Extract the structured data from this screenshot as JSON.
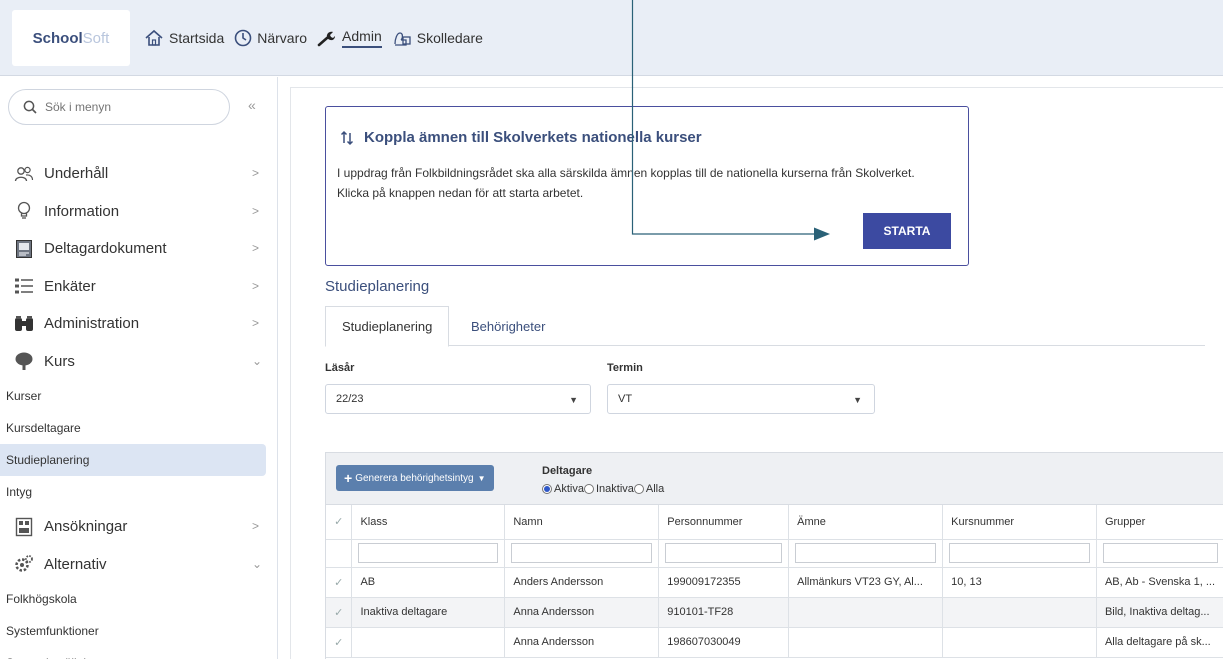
{
  "app": {
    "logo_part1": "School",
    "logo_part2": "Soft"
  },
  "topnav": [
    {
      "label": "Startsida",
      "icon": "home-icon"
    },
    {
      "label": "Närvaro",
      "icon": "clock-icon"
    },
    {
      "label": "Admin",
      "icon": "wrench-icon"
    },
    {
      "label": "Skolledare",
      "icon": "users-icon"
    }
  ],
  "sidebar": {
    "search_placeholder": "Sök i menyn",
    "collapse": "«",
    "items": [
      {
        "label": "Underhåll",
        "icon": "people-icon"
      },
      {
        "label": "Information",
        "icon": "bulb-icon"
      },
      {
        "label": "Deltagardokument",
        "icon": "document-icon"
      },
      {
        "label": "Enkäter",
        "icon": "list-icon"
      },
      {
        "label": "Administration",
        "icon": "binoculars-icon"
      },
      {
        "label": "Kurs",
        "icon": "tree-icon"
      }
    ],
    "kurs_sub": [
      "Kurser",
      "Kursdeltagare",
      "Studieplanering",
      "Intyg"
    ],
    "items2": [
      {
        "label": "Ansökningar",
        "icon": "form-icon"
      },
      {
        "label": "Alternativ",
        "icon": "gears-icon"
      }
    ],
    "alt_sub": [
      "Folkhögskola",
      "Systemfunktioner",
      "Systeminställningar"
    ]
  },
  "banner": {
    "title": "Koppla ämnen till Skolverkets nationella kurser",
    "text": "I uppdrag från Folkbildningsrådet ska alla särskilda ämnen kopplas till de nationella kurserna från Skolverket. Klicka på knappen nedan för att starta arbetet.",
    "button": "STARTA"
  },
  "page": {
    "title": "Studieplanering",
    "tabs": [
      "Studieplanering",
      "Behörigheter"
    ]
  },
  "filters": {
    "lasar_label": "Läsår",
    "lasar_value": "22/23",
    "termin_label": "Termin",
    "termin_value": "VT"
  },
  "grid": {
    "generate_button": "Generera behörighetsintyg",
    "deltagare_label": "Deltagare",
    "radio_options": [
      "Aktiva",
      "Inaktiva",
      "Alla"
    ],
    "selected_radio": "Aktiva",
    "columns": [
      "Klass",
      "Namn",
      "Personnummer",
      "Ämne",
      "Kursnummer",
      "Grupper"
    ],
    "rows": [
      [
        "AB",
        "Anders Andersson",
        "199009172355",
        "Allmänkurs VT23 GY, Al...",
        "10, 13",
        "AB, Ab - Svenska 1, ..."
      ],
      [
        "Inaktiva deltagare",
        "Anna Andersson",
        "910101-TF28",
        "",
        "",
        "Bild, Inaktiva deltag..."
      ],
      [
        "",
        "Anna Andersson",
        "198607030049",
        "",
        "",
        "Alla deltagare på sk..."
      ]
    ]
  },
  "colors": {
    "accent": "#3b4f7c",
    "start_button": "#3c4aa1",
    "generate_button": "#5b7fad",
    "active_menu_bg": "#dce5f3",
    "annotation_arrow": "#2a6177"
  }
}
